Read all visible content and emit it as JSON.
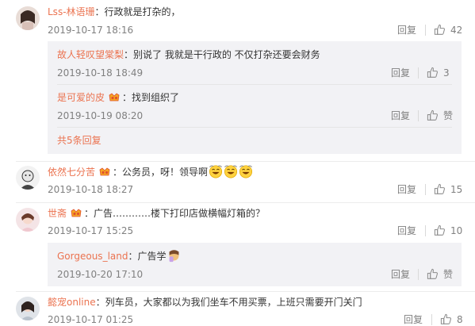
{
  "comments": [
    {
      "user": "Lss-林语珊",
      "text": "：行政就是打杂的，",
      "time": "2019-10-17 18:16",
      "reply_label": "回复",
      "likes": "42",
      "replies": [
        {
          "user": "故人轻叹望棠梨",
          "text": "：别说了 我就是干行政的 不仅打杂还要会财务",
          "time": "2019-10-18 18:49",
          "reply_label": "回复",
          "likes": "3"
        },
        {
          "user": "是可爱的皮",
          "text": "：找到组织了",
          "time": "2019-10-19 08:20",
          "reply_label": "回复",
          "likes": "赞"
        }
      ],
      "more_replies": "共5条回复"
    },
    {
      "user": "依然七分苦",
      "text": "：公务员，呀！领导啊",
      "time": "2019-10-18 18:27",
      "reply_label": "回复",
      "likes": "15"
    },
    {
      "user": "世斋",
      "text": "：广告…………楼下打印店做横幅灯箱的？",
      "time": "2019-10-17 15:25",
      "reply_label": "回复",
      "likes": "10",
      "replies": [
        {
          "user": "Gorgeous_land",
          "text": "：广告学",
          "time": "2019-10-20 17:10",
          "reply_label": "回复",
          "likes": "赞"
        }
      ]
    },
    {
      "user": "懿宠online",
      "text": "：列车员，大家都以为我们坐车不用买票，上班只需要开门关门",
      "time": "2019-10-17 01:25",
      "reply_label": "回复",
      "likes": "8"
    }
  ],
  "colors": {
    "username": "#eb7350",
    "meta": "#808080",
    "reply_bg": "#f2f2f5"
  },
  "icons": [
    "thumbs-up-icon",
    "vip-badge-icon",
    "laughing-emoji-icon",
    "facepalm-emoji-icon"
  ]
}
